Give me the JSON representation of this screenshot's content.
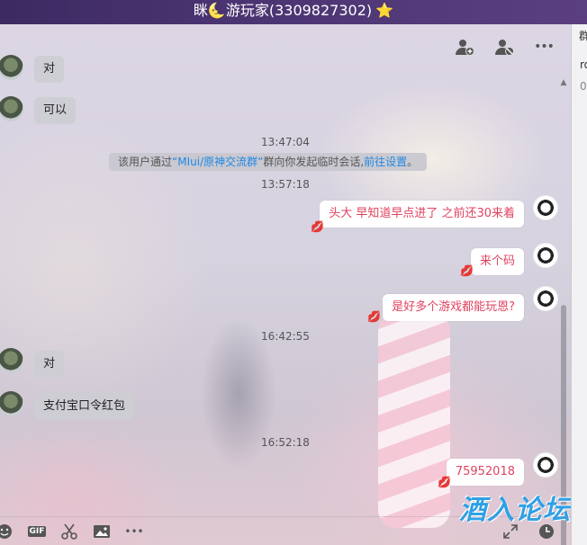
{
  "window": {
    "title": "眯🌜游玩家(3309827302)",
    "star": "⭐"
  },
  "top_actions": {
    "add_member_icon": "person-add-icon",
    "block_icon": "person-block-icon",
    "more_icon": "more-icon",
    "more_glyph": "•••"
  },
  "messages": {
    "m1": "对",
    "m2": "可以",
    "t1": "13:47:04",
    "sys_prefix": "该用户通过",
    "sys_group": "“MIui/原神交流群”",
    "sys_mid": "群向你发起临时会话,",
    "sys_link": "前往设置",
    "sys_end": "。",
    "t2": "13:57:18",
    "r1": "头大 早知道早点进了 之前还30来着",
    "r2": "来个码",
    "r3": "是好多个游戏都能玩恩?",
    "t3": "16:42:55",
    "m3": "对",
    "m4": "支付宝口令红包",
    "t4": "16:52:18",
    "r4": "75952018"
  },
  "toolbar": {
    "gif_label": "GIF",
    "more_glyph": "•••"
  },
  "watermark": "酒入论坛",
  "side_panel": {
    "c1": "群",
    "c2": "ro",
    "c3": "0-"
  },
  "colors": {
    "title_bg": "#4b3472",
    "bubble_right_text": "#e0435f",
    "link": "#1e88e5",
    "watermark": "#2fa0e6"
  }
}
